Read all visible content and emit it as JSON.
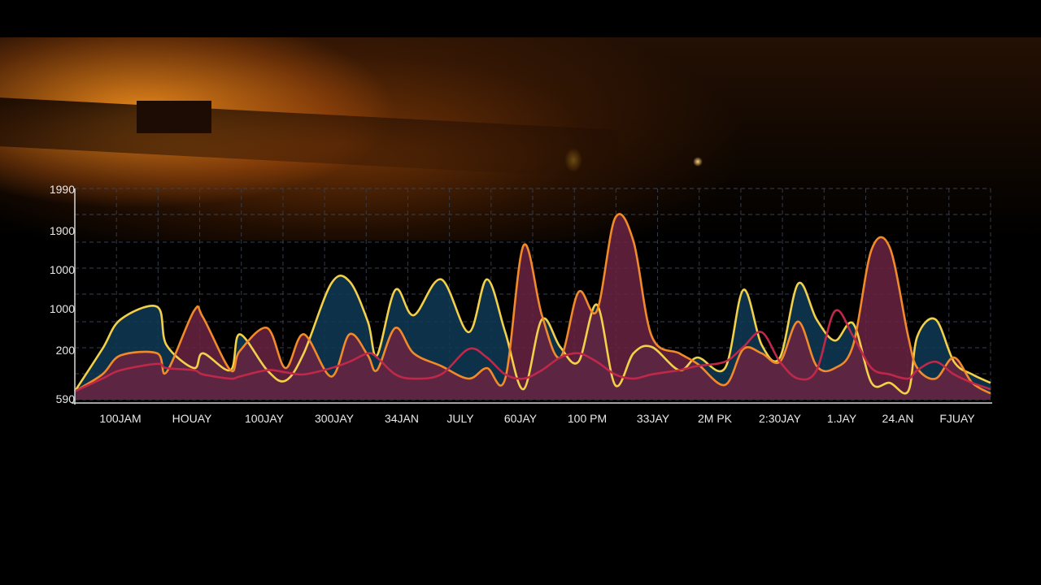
{
  "chart_data": {
    "type": "area",
    "y_tick_labels": [
      "1990",
      "1900",
      "1000",
      "1000",
      "200",
      "590"
    ],
    "x_tick_labels": [
      "100JAM",
      "HOUAY",
      "100JAY",
      "300JAY",
      "34JAN",
      "JULY",
      "60JAY",
      "100 PM",
      "33JAY",
      "2M PK",
      "2:30JAY",
      "1.JAY",
      "24.AN",
      "FJUAY"
    ],
    "grid": true,
    "ylim": [
      0,
      1
    ],
    "x": [
      0.0,
      0.03,
      0.05,
      0.09,
      0.1,
      0.13,
      0.14,
      0.17,
      0.18,
      0.21,
      0.23,
      0.25,
      0.28,
      0.3,
      0.32,
      0.33,
      0.35,
      0.37,
      0.4,
      0.43,
      0.45,
      0.47,
      0.49,
      0.51,
      0.53,
      0.55,
      0.57,
      0.59,
      0.61,
      0.63,
      0.66,
      0.68,
      0.71,
      0.73,
      0.75,
      0.77,
      0.79,
      0.81,
      0.83,
      0.85,
      0.87,
      0.89,
      0.91,
      0.92,
      0.94,
      0.96,
      0.98,
      1.0
    ],
    "series": [
      {
        "color": "#f3d04a",
        "fill": "#0e3a55",
        "values": [
          0.04,
          0.24,
          0.38,
          0.44,
          0.26,
          0.15,
          0.22,
          0.14,
          0.31,
          0.14,
          0.09,
          0.22,
          0.55,
          0.56,
          0.37,
          0.21,
          0.52,
          0.4,
          0.57,
          0.32,
          0.57,
          0.32,
          0.05,
          0.38,
          0.25,
          0.18,
          0.45,
          0.07,
          0.22,
          0.25,
          0.14,
          0.2,
          0.15,
          0.52,
          0.26,
          0.2,
          0.55,
          0.38,
          0.28,
          0.36,
          0.08,
          0.08,
          0.04,
          0.3,
          0.38,
          0.18,
          0.12,
          0.08
        ]
      },
      {
        "color": "#f28a2a",
        "fill": "#6b2342",
        "values": [
          0.04,
          0.12,
          0.21,
          0.22,
          0.13,
          0.42,
          0.39,
          0.14,
          0.23,
          0.34,
          0.15,
          0.31,
          0.11,
          0.31,
          0.21,
          0.14,
          0.34,
          0.22,
          0.16,
          0.1,
          0.15,
          0.1,
          0.73,
          0.4,
          0.2,
          0.51,
          0.42,
          0.86,
          0.75,
          0.3,
          0.22,
          0.17,
          0.07,
          0.24,
          0.22,
          0.18,
          0.37,
          0.16,
          0.15,
          0.26,
          0.71,
          0.72,
          0.3,
          0.15,
          0.1,
          0.2,
          0.08,
          0.03
        ]
      },
      {
        "color": "#c0284a",
        "fill": "none",
        "values": [
          0.04,
          0.1,
          0.14,
          0.17,
          0.15,
          0.14,
          0.12,
          0.1,
          0.11,
          0.14,
          0.13,
          0.12,
          0.15,
          0.18,
          0.22,
          0.2,
          0.12,
          0.1,
          0.12,
          0.24,
          0.2,
          0.12,
          0.1,
          0.14,
          0.2,
          0.22,
          0.18,
          0.12,
          0.1,
          0.12,
          0.14,
          0.16,
          0.18,
          0.25,
          0.32,
          0.18,
          0.1,
          0.14,
          0.42,
          0.3,
          0.15,
          0.12,
          0.1,
          0.14,
          0.18,
          0.12,
          0.08,
          0.05
        ]
      }
    ]
  }
}
